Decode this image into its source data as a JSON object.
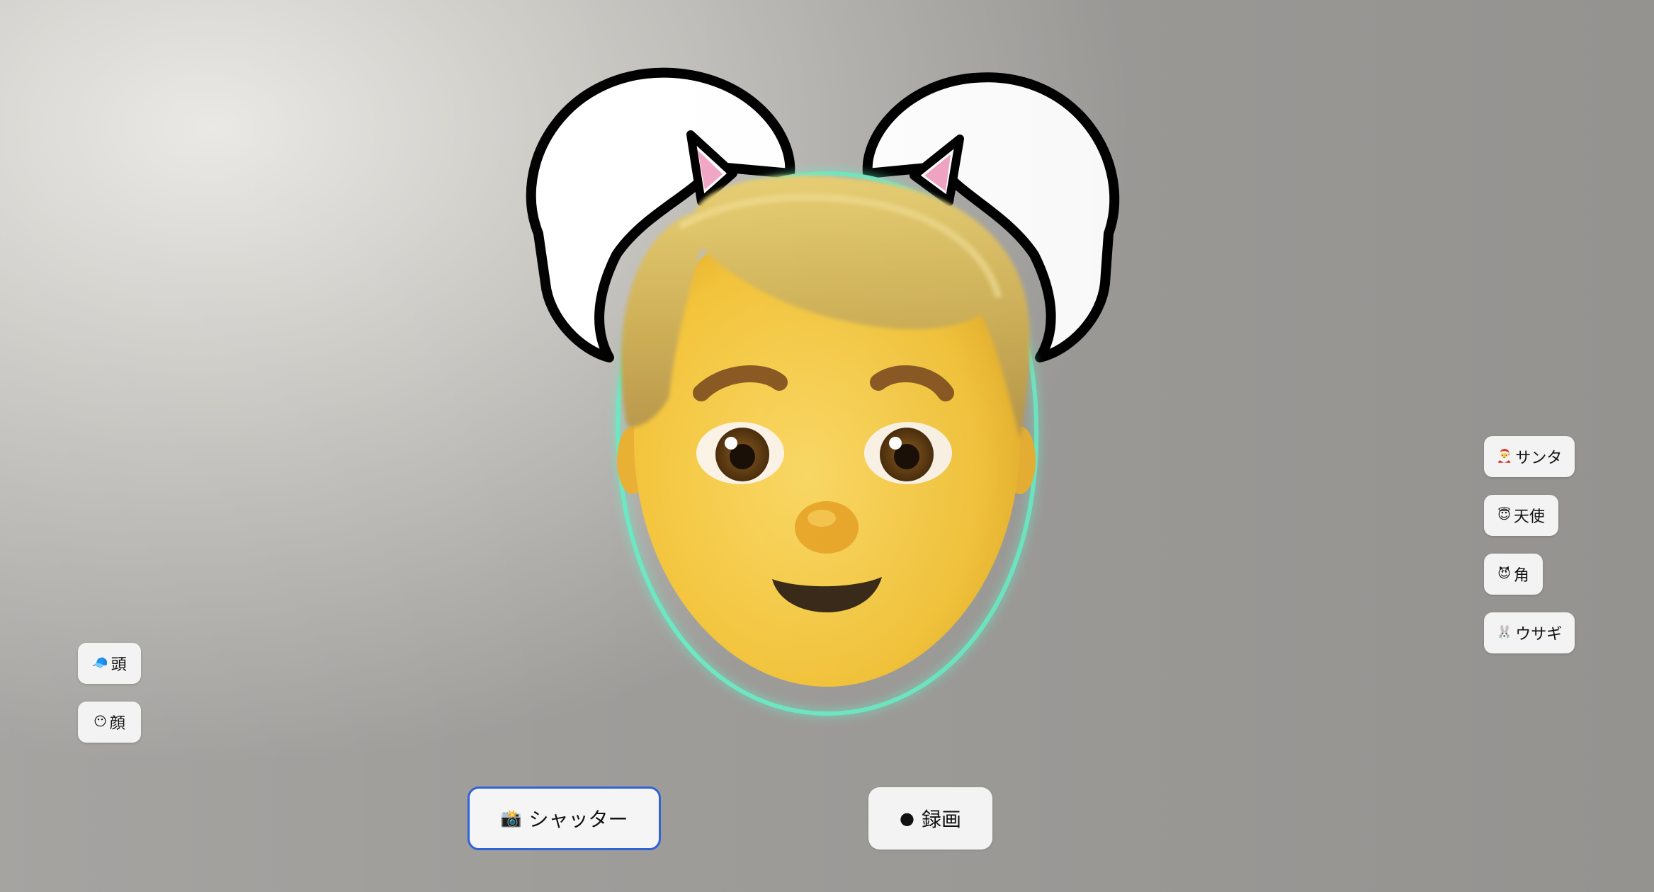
{
  "colors": {
    "face_outline_glow": "#6ee7c3",
    "shutter_focus_border": "#2f63d6",
    "button_bg": "#f3f3f3",
    "cat_ear_pink": "#f3a6c6"
  },
  "right_menu": {
    "items": [
      {
        "icon": "🎅",
        "icon_name": "santa-icon",
        "label": "サンタ"
      },
      {
        "icon": "😇",
        "icon_name": "angel-icon",
        "label": "天使"
      },
      {
        "icon": "😈",
        "icon_name": "devil-icon",
        "label": "角"
      },
      {
        "icon": "🐰",
        "icon_name": "rabbit-icon",
        "label": "ウサギ"
      }
    ]
  },
  "left_menu": {
    "items": [
      {
        "icon": "🧢",
        "icon_name": "cap-icon",
        "label": "頭"
      },
      {
        "icon": "😶",
        "icon_name": "face-icon",
        "label": "顔"
      }
    ]
  },
  "bottom_bar": {
    "shutter": {
      "icon": "📸",
      "icon_name": "camera-icon",
      "label": "シャッター"
    },
    "record": {
      "icon": "●",
      "icon_name": "record-dot-icon",
      "label": "録画"
    }
  }
}
